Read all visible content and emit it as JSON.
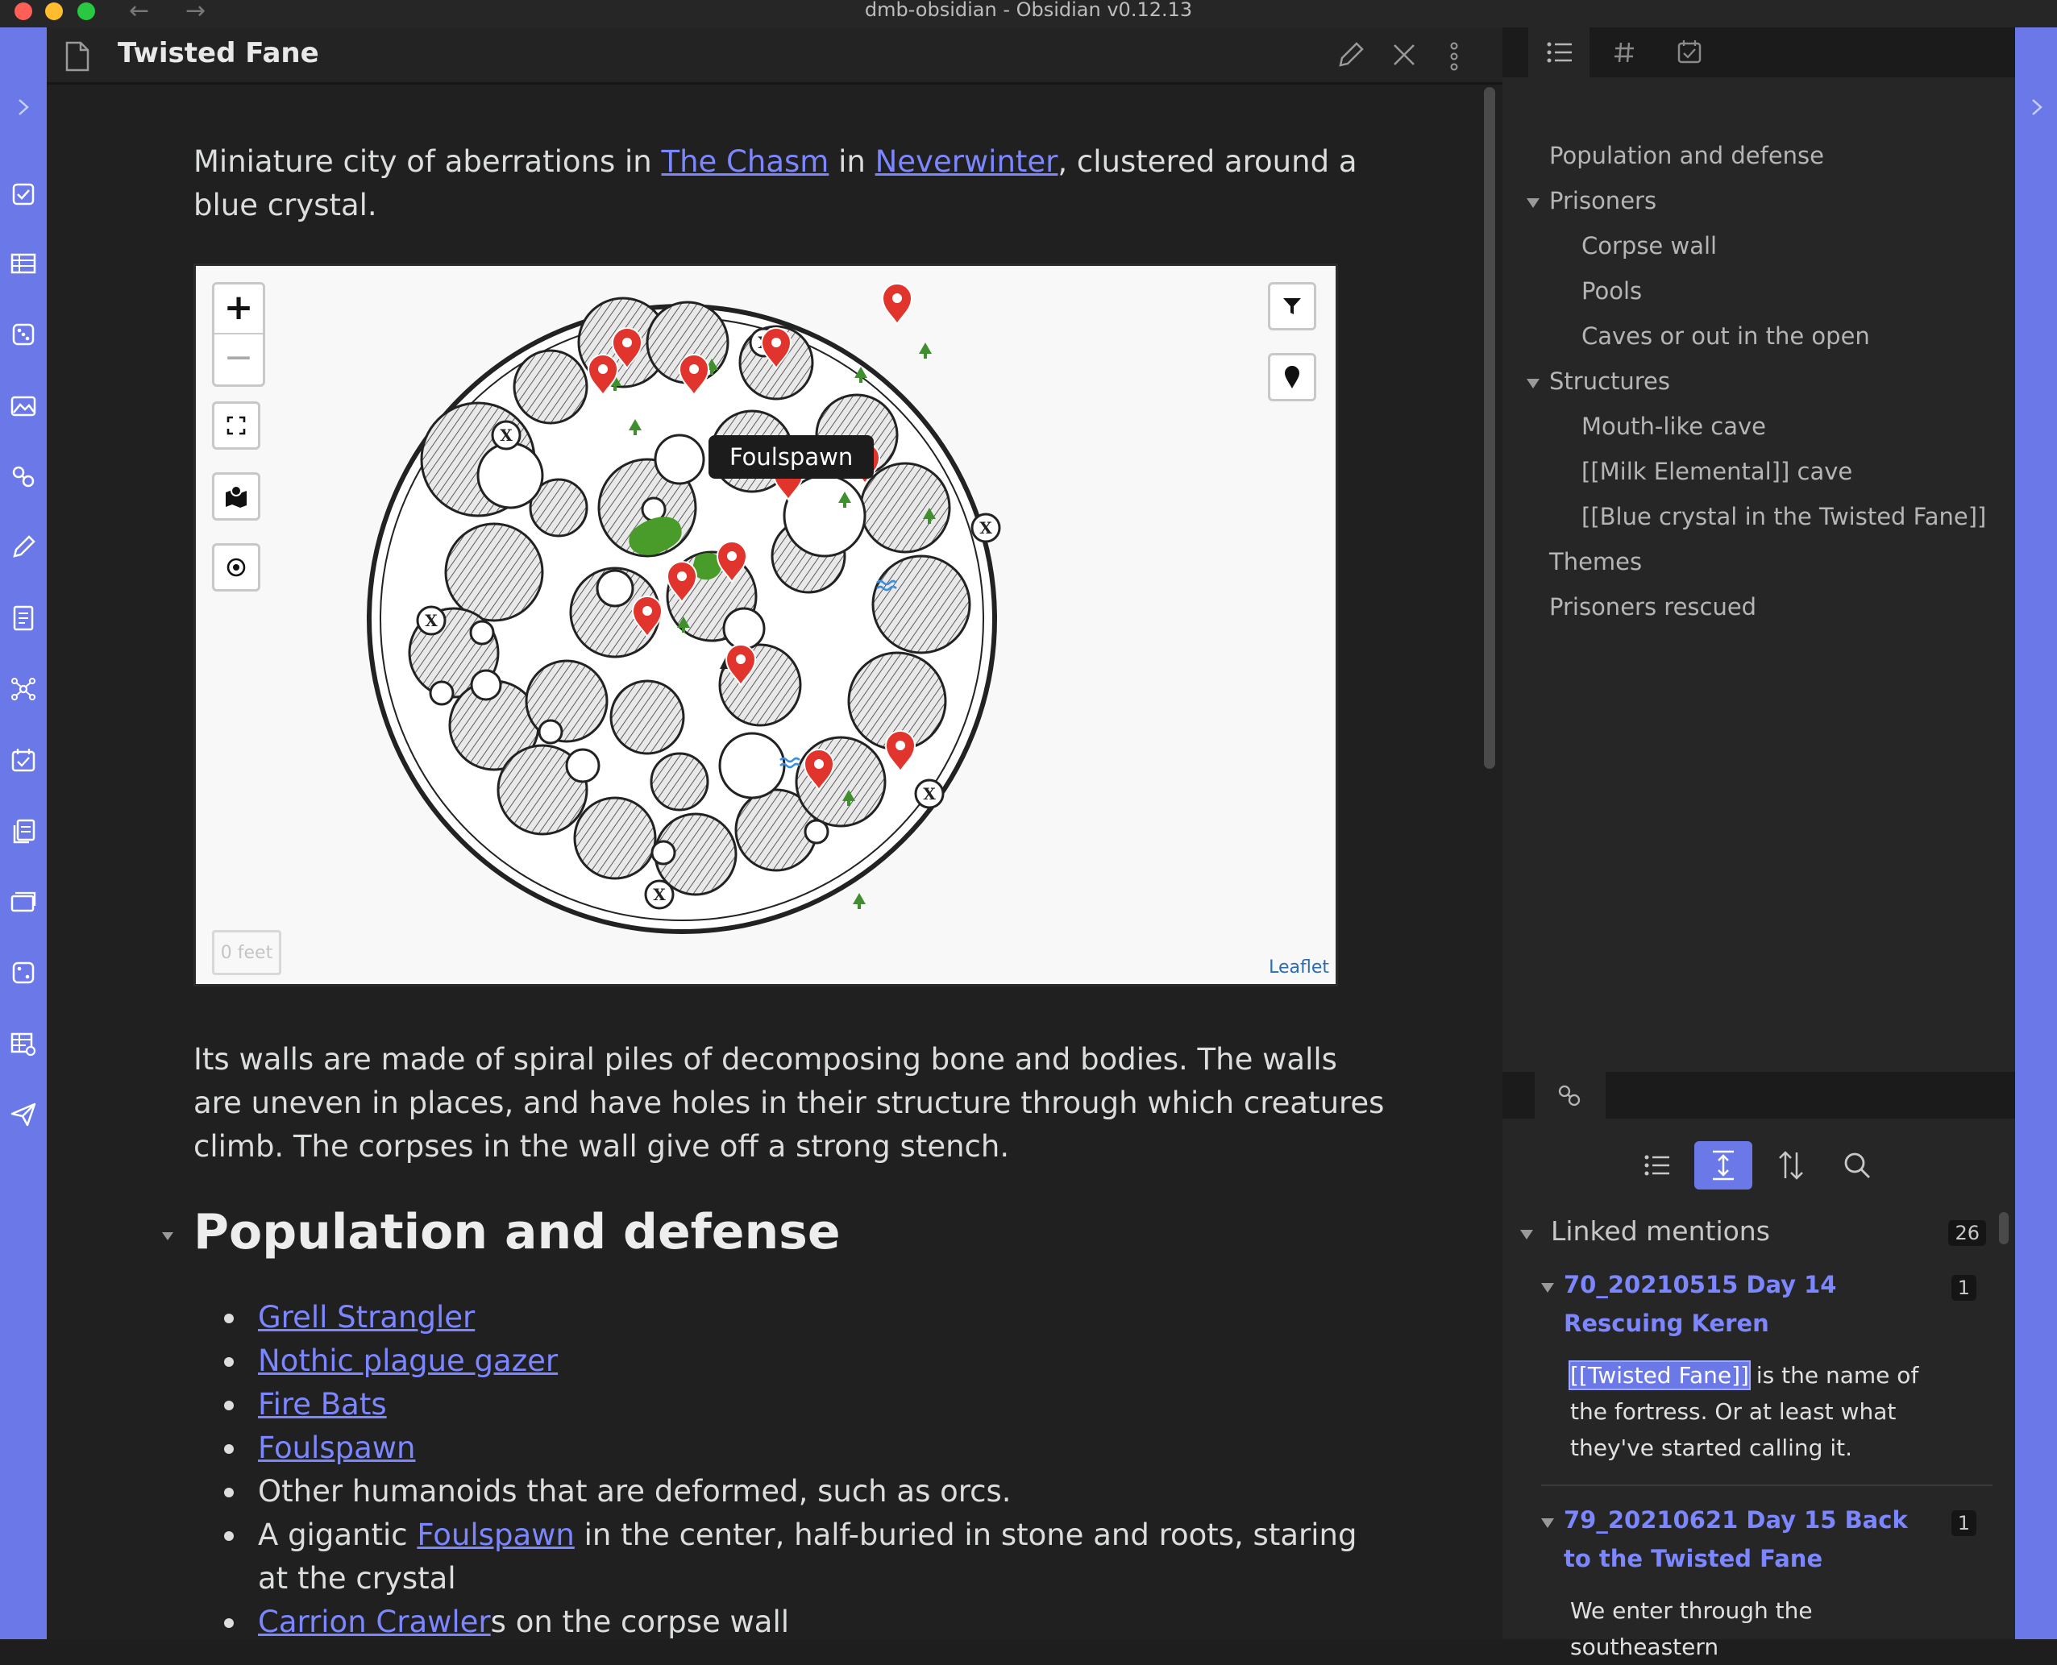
{
  "window": {
    "title": "dmb-obsidian - Obsidian v0.12.13"
  },
  "file": {
    "title": "Twisted Fane"
  },
  "note": {
    "intro": {
      "before": "Miniature city of aberrations in ",
      "link1": "The Chasm",
      "middle": " in ",
      "link2": "Neverwinter",
      "after": ", clustered around a blue crystal."
    },
    "map": {
      "zoom_in": "+",
      "zoom_out": "−",
      "tooltip": "Foulspawn",
      "scale": "0 feet",
      "attribution": "Leaflet",
      "marker_icon": "map-pin-icon",
      "tree_icon": "tree-icon",
      "portal_icon": "portal-x-icon",
      "water_icon": "water-icon"
    },
    "walls_paragraph": "Its walls are made of spiral piles of decomposing bone and bodies. The walls are uneven in places, and have holes in their structure through which creatures climb. The corpses in the wall give off a strong stench.",
    "heading": "Population and defense",
    "list": [
      {
        "link": "Grell Strangler",
        "rest": ""
      },
      {
        "link": "Nothic plague gazer",
        "rest": ""
      },
      {
        "link": "Fire Bats",
        "rest": ""
      },
      {
        "link": "Foulspawn",
        "rest": ""
      },
      {
        "pre": "Other humanoids that are deformed, such as orcs."
      },
      {
        "pre": "A gigantic ",
        "link": "Foulspawn",
        "rest": " in the center, half-buried in stone and roots, staring at the crystal"
      },
      {
        "link": "Carrion Crawler",
        "rest": "s on the corpse wall"
      }
    ]
  },
  "outline": [
    {
      "label": "Population and defense"
    },
    {
      "label": "Prisoners"
    },
    {
      "label": "Corpse wall"
    },
    {
      "label": "Pools"
    },
    {
      "label": "Caves or out in the open"
    },
    {
      "label": "Structures"
    },
    {
      "label": "Mouth-like cave"
    },
    {
      "label": "[[Milk Elemental]] cave"
    },
    {
      "label": "[[Blue crystal in the Twisted Fane]]"
    },
    {
      "label": "Themes"
    },
    {
      "label": "Prisoners rescued"
    }
  ],
  "backlinks": {
    "label": "Linked mentions",
    "count": "26",
    "results": [
      {
        "title": "70_20210515 Day 14 Rescuing Keren",
        "count": "1",
        "highlight": "[[Twisted Fane]]",
        "text": " is the name of the fortress. Or at least what they've started calling it."
      },
      {
        "title": "79_20210621 Day 15 Back to the Twisted Fane",
        "count": "1",
        "text": "We enter through the southeastern"
      }
    ]
  },
  "colors": {
    "accent": "#6b78e8",
    "link": "#7c86ff",
    "marker": "#e0342c",
    "tree": "#3f8f2f"
  }
}
